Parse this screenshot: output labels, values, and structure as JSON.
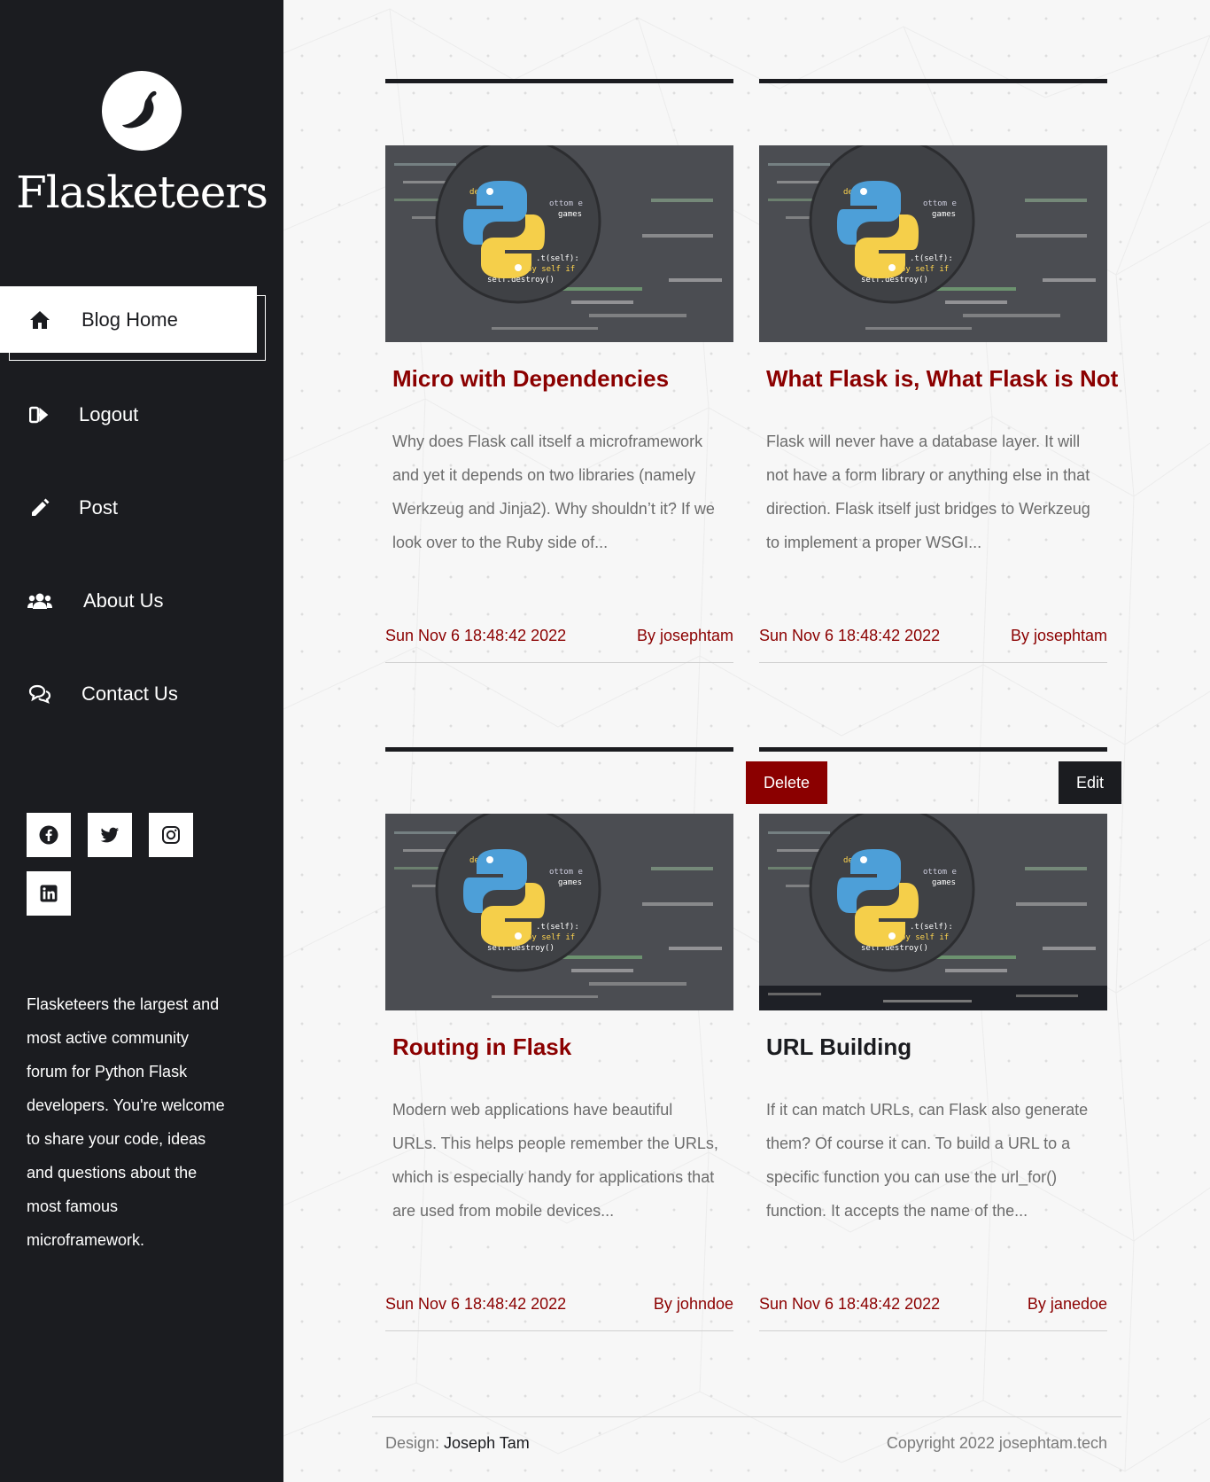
{
  "sidebar": {
    "brand": "Flasketeers",
    "nav": [
      {
        "label": "Blog Home",
        "icon": "home-icon",
        "active": true
      },
      {
        "label": "Logout",
        "icon": "sign-out-icon"
      },
      {
        "label": "Post",
        "icon": "pencil-icon"
      },
      {
        "label": "About Us",
        "icon": "users-icon"
      },
      {
        "label": "Contact Us",
        "icon": "comments-icon"
      }
    ],
    "social": [
      "facebook-icon",
      "twitter-icon",
      "instagram-icon",
      "linkedin-icon"
    ],
    "about": "Flasketeers the largest and most active community forum for Python Flask developers. You're welcome to share your code, ideas and questions about the most famous microframework."
  },
  "posts": [
    {
      "title": "Micro with Dependencies",
      "excerpt": "Why does Flask call itself a microframework and yet it depends on two libraries (namely Werkzeug and Jinja2). Why shouldn’t it? If we look over to the Ruby side of...",
      "date": "Sun Nov 6 18:48:42 2022",
      "author": "By josephtam"
    },
    {
      "title": "What Flask is, What Flask is Not",
      "excerpt": "Flask will never have a database layer. It will not have a form library or anything else in that direction. Flask itself just bridges to Werkzeug to implement a proper WSGI...",
      "date": "Sun Nov 6 18:48:42 2022",
      "author": "By josephtam"
    },
    {
      "title": "Routing in Flask",
      "excerpt": "Modern web applications have beautiful URLs. This helps people remember the URLs, which is especially handy for applications that are used from mobile devices...",
      "date": "Sun Nov 6 18:48:42 2022",
      "author": "By johndoe"
    },
    {
      "title": "URL Building",
      "excerpt": "If it can match URLs, can Flask also generate them? Of course it can. To build a URL to a specific function you can use the url_for() function. It accepts the name of the...",
      "date": "Sun Nov 6 18:48:42 2022",
      "author": "By janedoe"
    }
  ],
  "actions": {
    "delete": "Delete",
    "edit": "Edit"
  },
  "footer": {
    "design_label": "Design:",
    "design_name": "Joseph Tam",
    "copyright": "Copyright 2022 josephtam.tech"
  },
  "colors": {
    "accent": "#8b0000",
    "dark": "#1b1c20"
  }
}
